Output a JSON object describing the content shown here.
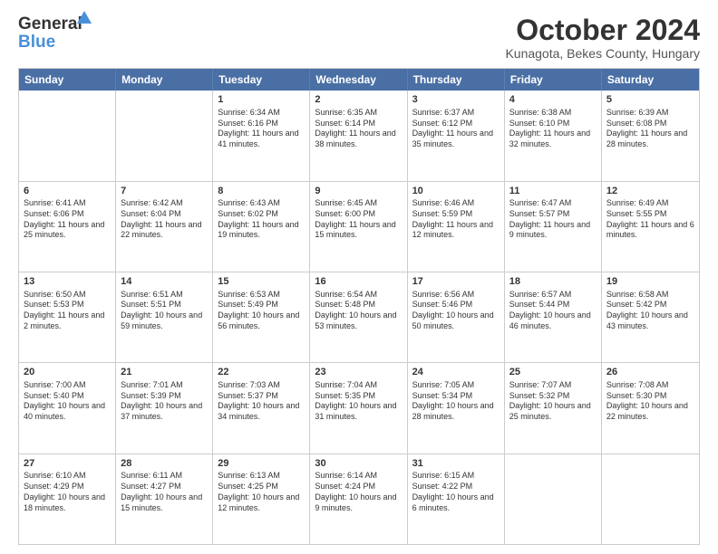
{
  "header": {
    "logo_general": "General",
    "logo_blue": "Blue",
    "month_title": "October 2024",
    "location": "Kunagota, Bekes County, Hungary"
  },
  "calendar": {
    "days_of_week": [
      "Sunday",
      "Monday",
      "Tuesday",
      "Wednesday",
      "Thursday",
      "Friday",
      "Saturday"
    ],
    "weeks": [
      [
        {
          "day": "",
          "sunrise": "",
          "sunset": "",
          "daylight": ""
        },
        {
          "day": "",
          "sunrise": "",
          "sunset": "",
          "daylight": ""
        },
        {
          "day": "1",
          "sunrise": "Sunrise: 6:34 AM",
          "sunset": "Sunset: 6:16 PM",
          "daylight": "Daylight: 11 hours and 41 minutes."
        },
        {
          "day": "2",
          "sunrise": "Sunrise: 6:35 AM",
          "sunset": "Sunset: 6:14 PM",
          "daylight": "Daylight: 11 hours and 38 minutes."
        },
        {
          "day": "3",
          "sunrise": "Sunrise: 6:37 AM",
          "sunset": "Sunset: 6:12 PM",
          "daylight": "Daylight: 11 hours and 35 minutes."
        },
        {
          "day": "4",
          "sunrise": "Sunrise: 6:38 AM",
          "sunset": "Sunset: 6:10 PM",
          "daylight": "Daylight: 11 hours and 32 minutes."
        },
        {
          "day": "5",
          "sunrise": "Sunrise: 6:39 AM",
          "sunset": "Sunset: 6:08 PM",
          "daylight": "Daylight: 11 hours and 28 minutes."
        }
      ],
      [
        {
          "day": "6",
          "sunrise": "Sunrise: 6:41 AM",
          "sunset": "Sunset: 6:06 PM",
          "daylight": "Daylight: 11 hours and 25 minutes."
        },
        {
          "day": "7",
          "sunrise": "Sunrise: 6:42 AM",
          "sunset": "Sunset: 6:04 PM",
          "daylight": "Daylight: 11 hours and 22 minutes."
        },
        {
          "day": "8",
          "sunrise": "Sunrise: 6:43 AM",
          "sunset": "Sunset: 6:02 PM",
          "daylight": "Daylight: 11 hours and 19 minutes."
        },
        {
          "day": "9",
          "sunrise": "Sunrise: 6:45 AM",
          "sunset": "Sunset: 6:00 PM",
          "daylight": "Daylight: 11 hours and 15 minutes."
        },
        {
          "day": "10",
          "sunrise": "Sunrise: 6:46 AM",
          "sunset": "Sunset: 5:59 PM",
          "daylight": "Daylight: 11 hours and 12 minutes."
        },
        {
          "day": "11",
          "sunrise": "Sunrise: 6:47 AM",
          "sunset": "Sunset: 5:57 PM",
          "daylight": "Daylight: 11 hours and 9 minutes."
        },
        {
          "day": "12",
          "sunrise": "Sunrise: 6:49 AM",
          "sunset": "Sunset: 5:55 PM",
          "daylight": "Daylight: 11 hours and 6 minutes."
        }
      ],
      [
        {
          "day": "13",
          "sunrise": "Sunrise: 6:50 AM",
          "sunset": "Sunset: 5:53 PM",
          "daylight": "Daylight: 11 hours and 2 minutes."
        },
        {
          "day": "14",
          "sunrise": "Sunrise: 6:51 AM",
          "sunset": "Sunset: 5:51 PM",
          "daylight": "Daylight: 10 hours and 59 minutes."
        },
        {
          "day": "15",
          "sunrise": "Sunrise: 6:53 AM",
          "sunset": "Sunset: 5:49 PM",
          "daylight": "Daylight: 10 hours and 56 minutes."
        },
        {
          "day": "16",
          "sunrise": "Sunrise: 6:54 AM",
          "sunset": "Sunset: 5:48 PM",
          "daylight": "Daylight: 10 hours and 53 minutes."
        },
        {
          "day": "17",
          "sunrise": "Sunrise: 6:56 AM",
          "sunset": "Sunset: 5:46 PM",
          "daylight": "Daylight: 10 hours and 50 minutes."
        },
        {
          "day": "18",
          "sunrise": "Sunrise: 6:57 AM",
          "sunset": "Sunset: 5:44 PM",
          "daylight": "Daylight: 10 hours and 46 minutes."
        },
        {
          "day": "19",
          "sunrise": "Sunrise: 6:58 AM",
          "sunset": "Sunset: 5:42 PM",
          "daylight": "Daylight: 10 hours and 43 minutes."
        }
      ],
      [
        {
          "day": "20",
          "sunrise": "Sunrise: 7:00 AM",
          "sunset": "Sunset: 5:40 PM",
          "daylight": "Daylight: 10 hours and 40 minutes."
        },
        {
          "day": "21",
          "sunrise": "Sunrise: 7:01 AM",
          "sunset": "Sunset: 5:39 PM",
          "daylight": "Daylight: 10 hours and 37 minutes."
        },
        {
          "day": "22",
          "sunrise": "Sunrise: 7:03 AM",
          "sunset": "Sunset: 5:37 PM",
          "daylight": "Daylight: 10 hours and 34 minutes."
        },
        {
          "day": "23",
          "sunrise": "Sunrise: 7:04 AM",
          "sunset": "Sunset: 5:35 PM",
          "daylight": "Daylight: 10 hours and 31 minutes."
        },
        {
          "day": "24",
          "sunrise": "Sunrise: 7:05 AM",
          "sunset": "Sunset: 5:34 PM",
          "daylight": "Daylight: 10 hours and 28 minutes."
        },
        {
          "day": "25",
          "sunrise": "Sunrise: 7:07 AM",
          "sunset": "Sunset: 5:32 PM",
          "daylight": "Daylight: 10 hours and 25 minutes."
        },
        {
          "day": "26",
          "sunrise": "Sunrise: 7:08 AM",
          "sunset": "Sunset: 5:30 PM",
          "daylight": "Daylight: 10 hours and 22 minutes."
        }
      ],
      [
        {
          "day": "27",
          "sunrise": "Sunrise: 6:10 AM",
          "sunset": "Sunset: 4:29 PM",
          "daylight": "Daylight: 10 hours and 18 minutes."
        },
        {
          "day": "28",
          "sunrise": "Sunrise: 6:11 AM",
          "sunset": "Sunset: 4:27 PM",
          "daylight": "Daylight: 10 hours and 15 minutes."
        },
        {
          "day": "29",
          "sunrise": "Sunrise: 6:13 AM",
          "sunset": "Sunset: 4:25 PM",
          "daylight": "Daylight: 10 hours and 12 minutes."
        },
        {
          "day": "30",
          "sunrise": "Sunrise: 6:14 AM",
          "sunset": "Sunset: 4:24 PM",
          "daylight": "Daylight: 10 hours and 9 minutes."
        },
        {
          "day": "31",
          "sunrise": "Sunrise: 6:15 AM",
          "sunset": "Sunset: 4:22 PM",
          "daylight": "Daylight: 10 hours and 6 minutes."
        },
        {
          "day": "",
          "sunrise": "",
          "sunset": "",
          "daylight": ""
        },
        {
          "day": "",
          "sunrise": "",
          "sunset": "",
          "daylight": ""
        }
      ]
    ]
  }
}
